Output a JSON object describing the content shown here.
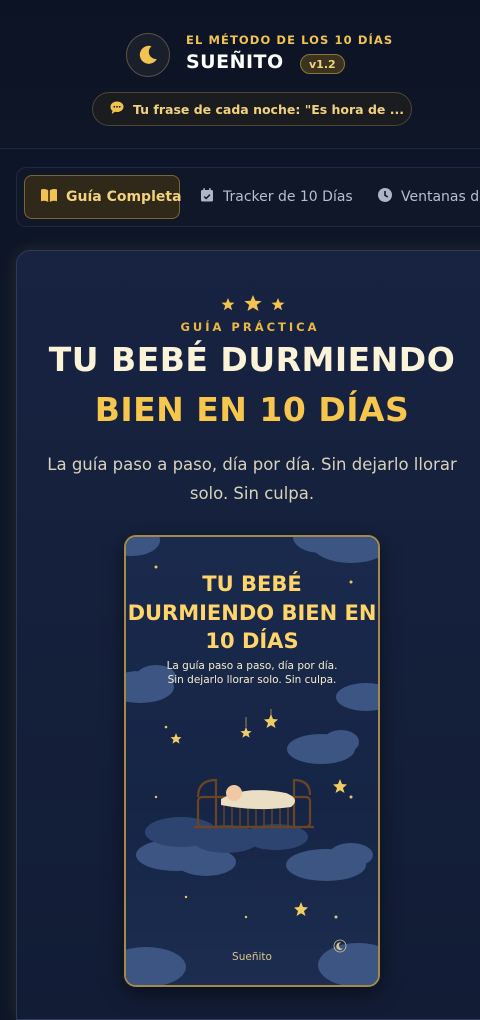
{
  "header": {
    "eyebrow": "EL MÉTODO DE LOS 10 DÍAS",
    "brand": "SUEÑITO",
    "version": "v1.2",
    "phrase": "Tu frase de cada noche: \"Es hora de ..."
  },
  "tabs": [
    {
      "label": "Guía Completa",
      "icon": "book-icon",
      "active": true
    },
    {
      "label": "Tracker de 10 Días",
      "icon": "calendar-check-icon",
      "active": false
    },
    {
      "label": "Ventanas de",
      "icon": "clock-icon",
      "active": false
    }
  ],
  "hero": {
    "kicker": "GUÍA PRÁCTICA",
    "title_line1": "TU BEBÉ DURMIENDO",
    "title_line2": "BIEN EN 10 DÍAS",
    "subtitle": "La guía paso a paso, día por día. Sin dejarlo llorar solo. Sin culpa."
  },
  "book_cover": {
    "title": "TU BEBÉ DURMIENDO BIEN EN 10 DÍAS",
    "subtitle_line1": "La guía paso a paso, día por día.",
    "subtitle_line2": "Sin dejarlo llorar solo. Sin culpa.",
    "brand": "Sueñito"
  },
  "colors": {
    "background": "#0d1528",
    "accent_gold": "#f2c350",
    "card": "#172341"
  }
}
